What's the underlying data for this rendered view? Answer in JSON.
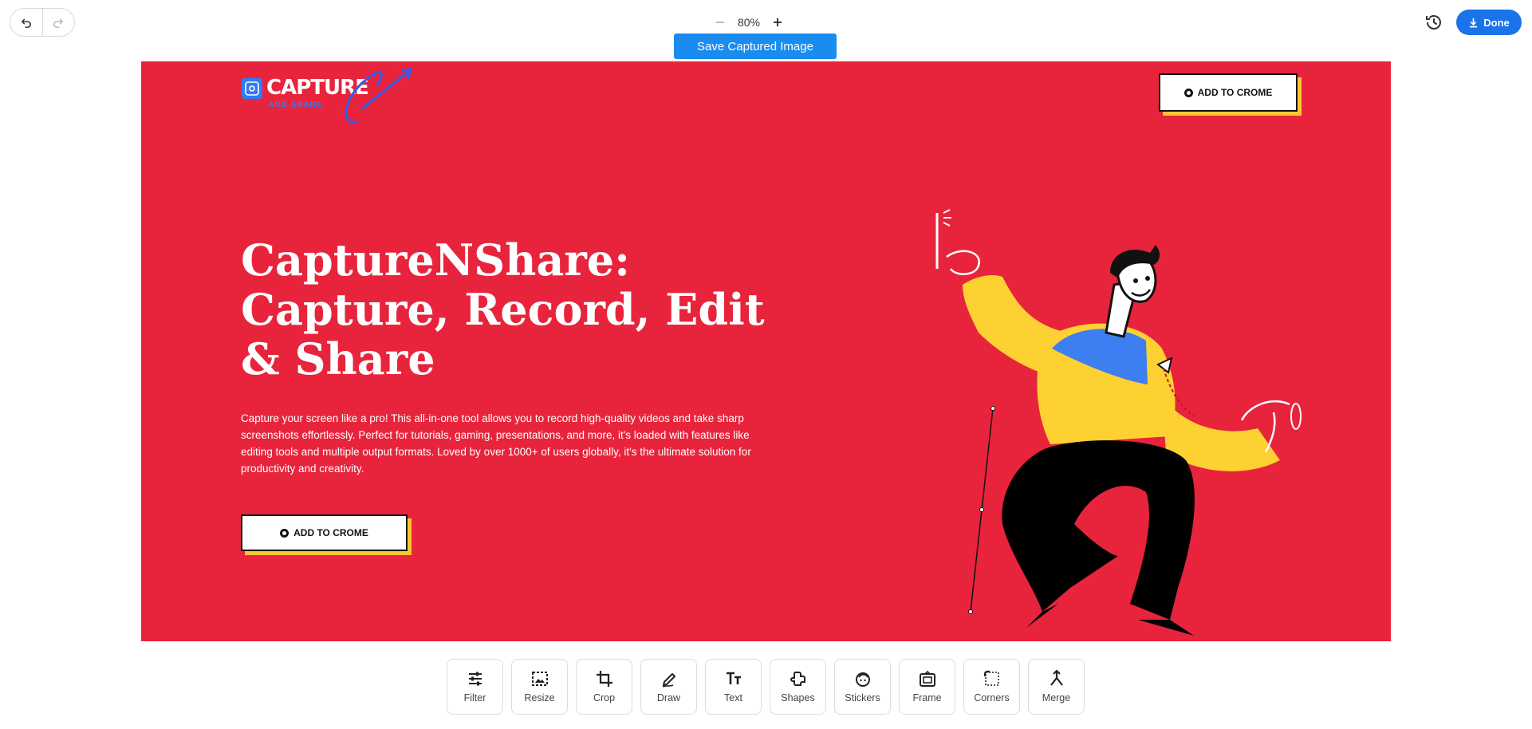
{
  "toolbar_top": {
    "undo_icon": "undo-icon",
    "redo_icon": "redo-icon",
    "zoom_value": "80%",
    "zoom_out_icon": "minus-icon",
    "zoom_in_icon": "plus-icon",
    "save_label": "Save Captured Image",
    "history_icon": "history-icon",
    "done_label": "Done"
  },
  "canvas": {
    "background": "#e8243c",
    "logo": {
      "text": "CAPTURE",
      "subtext": "AND SHARE"
    },
    "cta_top_label": "ADD TO CROME",
    "hero_title": "CaptureNShare: Capture, Record, Edit & Share",
    "hero_description": "Capture your screen like a pro! This all-in-one tool allows you to record high-quality videos and take sharp screenshots effortlessly. Perfect for tutorials, gaming, presentations, and more, it's loaded with features like editing tools and multiple output formats. Loved by over 1000+ of users globally, it's the ultimate solution for productivity and creativity.",
    "cta_main_label": "ADD TO CROME"
  },
  "tools": [
    {
      "label": "Filter",
      "icon": "sliders-icon"
    },
    {
      "label": "Resize",
      "icon": "resize-icon"
    },
    {
      "label": "Crop",
      "icon": "crop-icon"
    },
    {
      "label": "Draw",
      "icon": "pen-icon"
    },
    {
      "label": "Text",
      "icon": "text-icon"
    },
    {
      "label": "Shapes",
      "icon": "shapes-icon"
    },
    {
      "label": "Stickers",
      "icon": "sticker-icon"
    },
    {
      "label": "Frame",
      "icon": "frame-icon"
    },
    {
      "label": "Corners",
      "icon": "corners-icon"
    },
    {
      "label": "Merge",
      "icon": "merge-icon"
    }
  ],
  "colors": {
    "accent": "#1a73e8",
    "save_button": "#1a8cf0",
    "canvas_red": "#e8243c",
    "cta_shadow": "#f7c830"
  }
}
